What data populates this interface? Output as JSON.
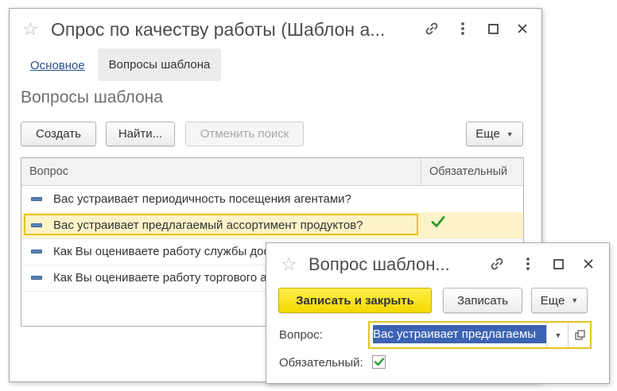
{
  "main_window": {
    "title": "Опрос по качеству работы (Шаблон а...",
    "tabs": [
      {
        "label": "Основное",
        "active": false
      },
      {
        "label": "Вопросы шаблона",
        "active": true
      }
    ],
    "section_title": "Вопросы шаблона",
    "toolbar": {
      "create_label": "Создать",
      "find_label": "Найти...",
      "cancel_search_label": "Отменить поиск",
      "more_label": "Еще"
    },
    "table": {
      "columns": [
        "Вопрос",
        "Обязательный"
      ],
      "rows": [
        {
          "question": "Вас устраивает периодичность посещения агентами?",
          "required": false,
          "selected": false
        },
        {
          "question": "Вас устраивает предлагаемый ассортимент продуктов?",
          "required": true,
          "selected": true
        },
        {
          "question": "Как Вы оцениваете работу службы доставки?",
          "required": false,
          "selected": false
        },
        {
          "question": "Как Вы оцениваете работу торгового агента?",
          "required": false,
          "selected": false
        }
      ]
    }
  },
  "sub_window": {
    "title": "Вопрос шаблон...",
    "toolbar": {
      "save_close_label": "Записать и закрыть",
      "save_label": "Записать",
      "more_label": "Еще"
    },
    "question_label": "Вопрос:",
    "question_value": "Вас устраивает предлагаемы",
    "required_label": "Обязательный:",
    "required_checked": true
  },
  "colors": {
    "accent_yellow": "#f3d800",
    "highlight_border": "#e8c31e",
    "selected_row": "#fcf4c8",
    "link": "#2a4e8f",
    "check_green": "#2e9a2e",
    "input_selection": "#3c63b3"
  },
  "icons": [
    "star-icon",
    "link-icon",
    "more-vertical-icon",
    "maximize-icon",
    "close-icon",
    "chevron-down-icon",
    "open-form-icon",
    "checkmark-icon"
  ]
}
